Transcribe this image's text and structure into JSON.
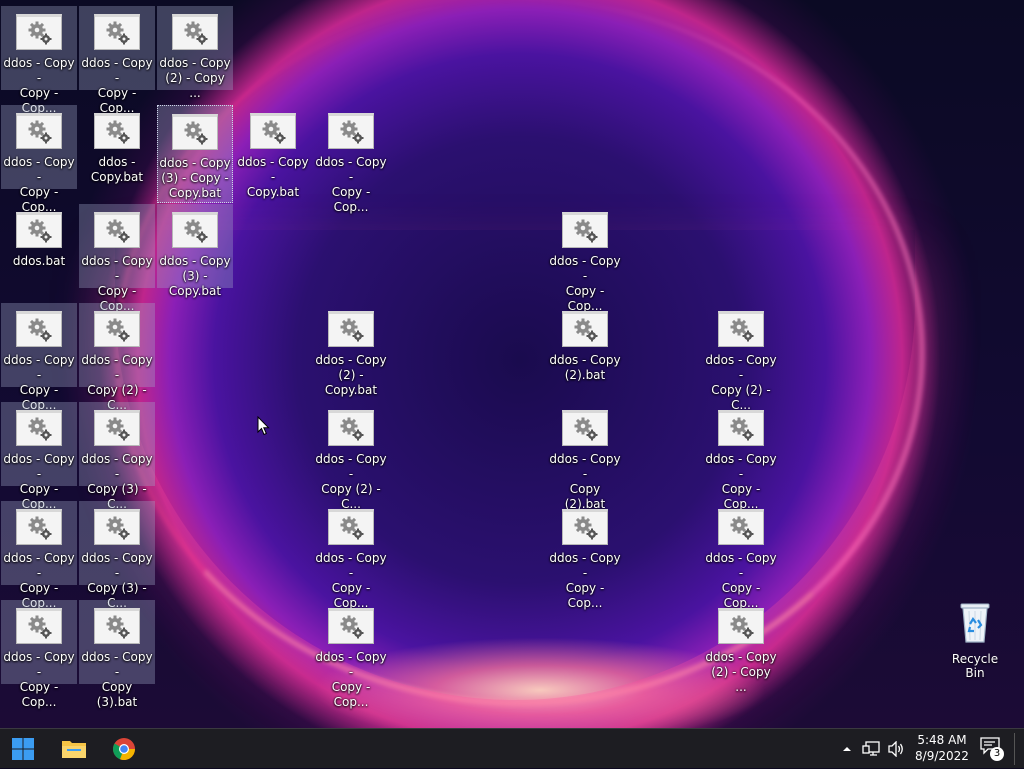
{
  "desktop": {
    "icons": [
      {
        "label": "ddos - Copy -\nCopy - Cop...",
        "selected": true
      },
      {
        "label": "ddos - Copy -\nCopy - Cop...",
        "selected": true
      },
      {
        "label": "ddos - Copy\n(2) - Copy ...",
        "selected": true
      },
      {
        "label": "ddos - Copy -\nCopy - Cop...",
        "selected": true
      },
      {
        "label": "ddos -\nCopy.bat",
        "selected": false
      },
      {
        "label": "ddos - Copy\n(3) - Copy -\nCopy.bat",
        "selected": true,
        "focused": true
      },
      {
        "label": "ddos - Copy -\nCopy.bat",
        "selected": false
      },
      {
        "label": "ddos - Copy -\nCopy - Cop...",
        "selected": false
      },
      {
        "label": "ddos.bat",
        "selected": false
      },
      {
        "label": "ddos - Copy -\nCopy - Cop...",
        "selected": true
      },
      {
        "label": "ddos - Copy\n(3) - Copy.bat",
        "selected": true
      },
      {
        "label": "ddos - Copy -\nCopy - Cop...",
        "selected": false
      },
      {
        "label": "ddos - Copy -\nCopy - Cop...",
        "selected": true
      },
      {
        "label": "ddos - Copy -\nCopy (2) - C...",
        "selected": true
      },
      {
        "label": "ddos - Copy\n(2) - Copy.bat",
        "selected": false
      },
      {
        "label": "ddos - Copy\n(2).bat",
        "selected": false
      },
      {
        "label": "ddos - Copy -\nCopy (2) - C...",
        "selected": false
      },
      {
        "label": "ddos - Copy -\nCopy - Cop...",
        "selected": true
      },
      {
        "label": "ddos - Copy -\nCopy (3) - C...",
        "selected": true
      },
      {
        "label": "ddos - Copy -\nCopy (2) - C...",
        "selected": false
      },
      {
        "label": "ddos - Copy -\nCopy (2).bat",
        "selected": false
      },
      {
        "label": "ddos - Copy -\nCopy - Cop...",
        "selected": false
      },
      {
        "label": "ddos - Copy -\nCopy - Cop...",
        "selected": true
      },
      {
        "label": "ddos - Copy -\nCopy (3) - C...",
        "selected": true
      },
      {
        "label": "ddos - Copy -\nCopy - Cop...",
        "selected": false
      },
      {
        "label": "ddos - Copy -\nCopy - Cop...",
        "selected": false
      },
      {
        "label": "ddos - Copy -\nCopy - Cop...",
        "selected": false
      },
      {
        "label": "ddos - Copy -\nCopy - Cop...",
        "selected": true
      },
      {
        "label": "ddos - Copy -\nCopy (3).bat",
        "selected": true
      },
      {
        "label": "ddos - Copy -\nCopy - Cop...",
        "selected": false
      },
      {
        "label": "ddos - Copy\n(2) - Copy ...",
        "selected": false
      }
    ],
    "recycle_bin": {
      "label": "Recycle Bin",
      "icon": "recycle-bin-icon"
    }
  },
  "taskbar": {
    "pinned": [
      {
        "name": "start-button",
        "icon": "windows-logo-icon"
      },
      {
        "name": "file-explorer-button",
        "icon": "folder-icon"
      },
      {
        "name": "chrome-button",
        "icon": "chrome-icon"
      }
    ],
    "tray": {
      "overflow_icon": "chevron-up-icon",
      "network_icon": "network-icon",
      "volume_icon": "volume-icon",
      "time": "5:48 AM",
      "date": "8/9/2022",
      "notification_count": "3"
    }
  },
  "colors": {
    "taskbar": "#1d1d22",
    "selection": "#a0aac8",
    "windows_blue": "#3b9cf2",
    "folder_yellow": "#f6c445"
  }
}
